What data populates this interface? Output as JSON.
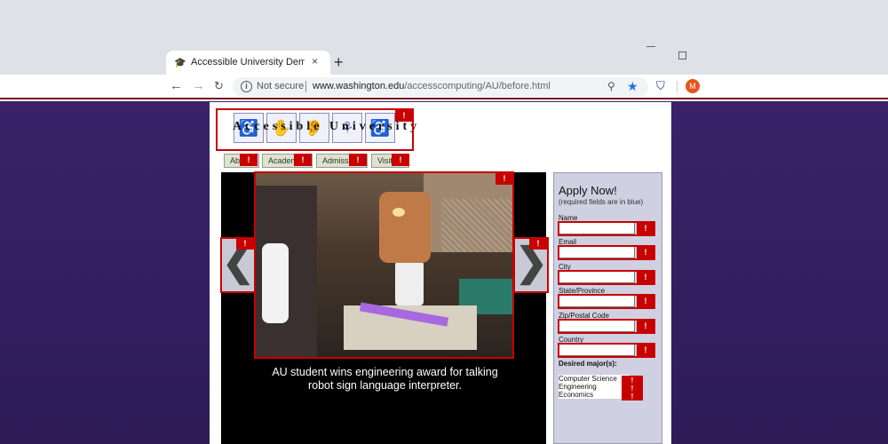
{
  "browser": {
    "tab_title": "Accessible University Demo Site",
    "tab_favicon": "mortarboard-icon",
    "close_tab": "×",
    "new_tab": "+",
    "nav": {
      "back": "←",
      "forward": "→",
      "reload": "C"
    },
    "security_label": "Not secure",
    "url_host": "www.washington.edu",
    "url_path": "/accesscomputing/AU/before.html",
    "avatar_letter": "M",
    "accent_color": "#1a73e8"
  },
  "site": {
    "logo_text": "Accessible University",
    "nav_tabs": [
      "About",
      "Academics",
      "Admissions",
      "Visitors"
    ],
    "error_marker": "!",
    "carousel": {
      "prev_label": "❮",
      "next_label": "❯",
      "caption": "AU student wins engineering award for talking robot sign language interpreter."
    },
    "form": {
      "title": "Apply Now!",
      "note": "(required fields are in blue)",
      "fields": [
        "Name",
        "Email",
        "City",
        "State/Province",
        "Zip/Postal Code",
        "Country"
      ],
      "majors_label": "Desired major(s):",
      "majors": [
        "Computer Science",
        "Engineering",
        "Economics"
      ]
    }
  },
  "colors": {
    "error_red": "#c80000",
    "page_background": "#2d1b58",
    "form_background": "#cfd1e2"
  }
}
